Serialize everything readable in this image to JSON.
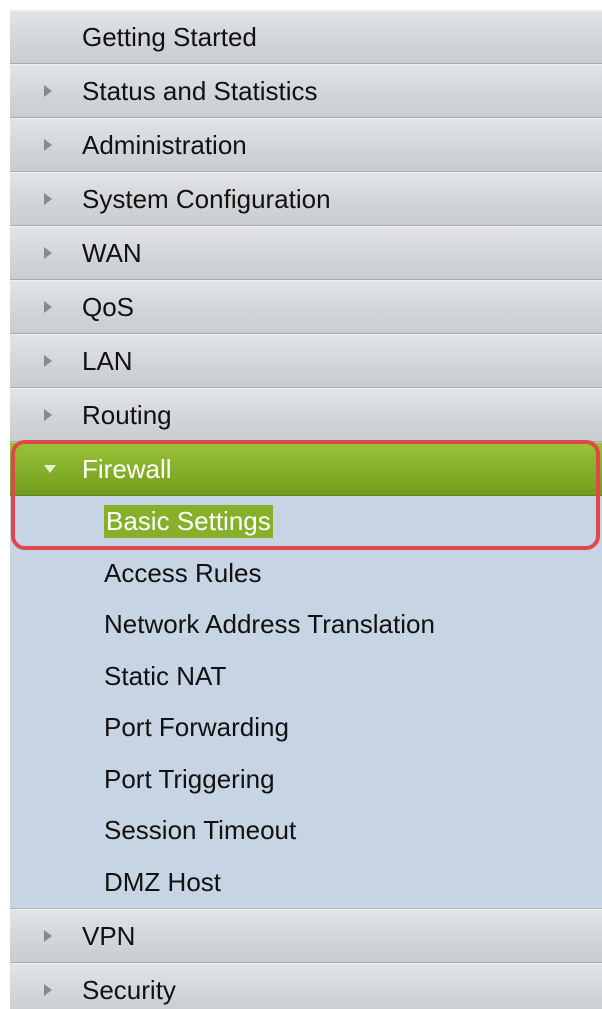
{
  "sidebar": {
    "items": [
      {
        "label": "Getting Started",
        "arrow": "none"
      },
      {
        "label": "Status and Statistics",
        "arrow": "right"
      },
      {
        "label": "Administration",
        "arrow": "right"
      },
      {
        "label": "System Configuration",
        "arrow": "right"
      },
      {
        "label": "WAN",
        "arrow": "right"
      },
      {
        "label": "QoS",
        "arrow": "right"
      },
      {
        "label": "LAN",
        "arrow": "right"
      },
      {
        "label": "Routing",
        "arrow": "right"
      },
      {
        "label": "Firewall",
        "arrow": "down"
      }
    ],
    "firewall_sub": [
      {
        "label": "Basic Settings",
        "selected": true
      },
      {
        "label": "Access Rules"
      },
      {
        "label": "Network Address Translation"
      },
      {
        "label": "Static NAT"
      },
      {
        "label": "Port Forwarding"
      },
      {
        "label": "Port Triggering"
      },
      {
        "label": "Session Timeout"
      },
      {
        "label": "DMZ Host"
      }
    ],
    "after": [
      {
        "label": "VPN",
        "arrow": "right"
      },
      {
        "label": "Security",
        "arrow": "right"
      }
    ]
  },
  "colors": {
    "active_green": "#86b02a",
    "submenu_bg": "#c6d4e3",
    "annotation_red": "#e0474c"
  }
}
